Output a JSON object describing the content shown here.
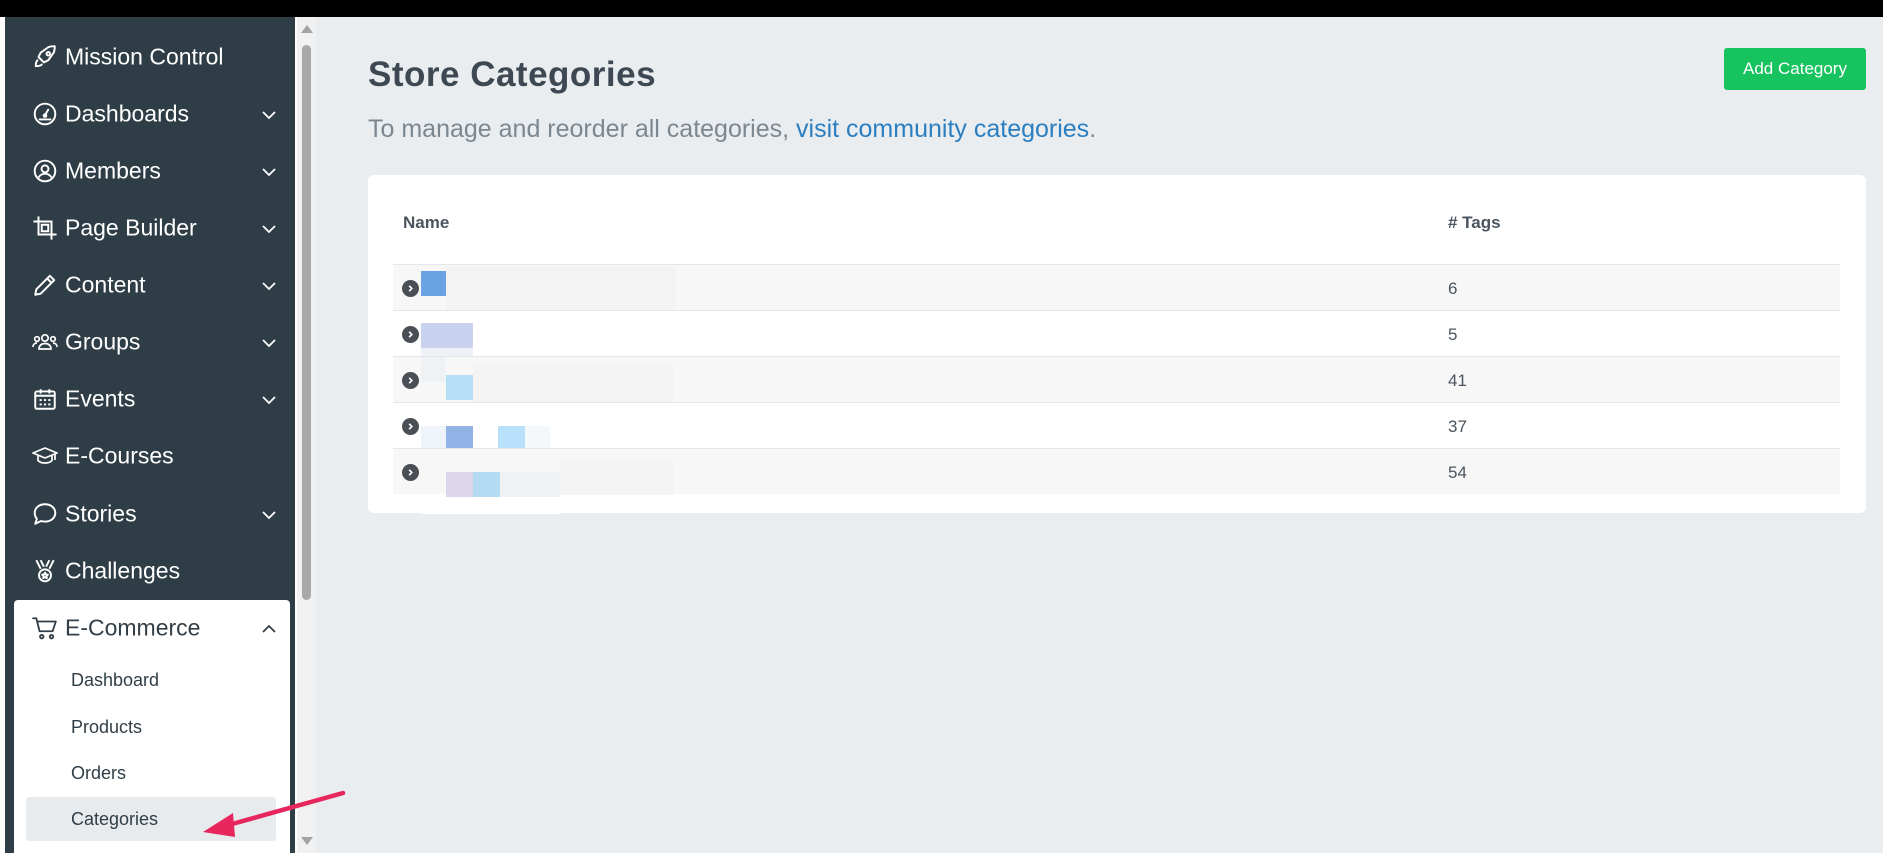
{
  "sidebar": {
    "items": [
      {
        "label": "Mission Control",
        "icon": "rocket-icon",
        "has_chevron": false
      },
      {
        "label": "Dashboards",
        "icon": "speedometer-icon",
        "has_chevron": true
      },
      {
        "label": "Members",
        "icon": "user-circle-icon",
        "has_chevron": true
      },
      {
        "label": "Page Builder",
        "icon": "crop-icon",
        "has_chevron": true
      },
      {
        "label": "Content",
        "icon": "pencil-icon",
        "has_chevron": true
      },
      {
        "label": "Groups",
        "icon": "users-icon",
        "has_chevron": true
      },
      {
        "label": "Events",
        "icon": "calendar-icon",
        "has_chevron": true
      },
      {
        "label": "E-Courses",
        "icon": "graduation-cap-icon",
        "has_chevron": false
      },
      {
        "label": "Stories",
        "icon": "chat-bubble-icon",
        "has_chevron": true
      },
      {
        "label": "Challenges",
        "icon": "medal-icon",
        "has_chevron": false
      }
    ],
    "ecommerce": {
      "label": "E-Commerce",
      "icon": "cart-icon",
      "sub_items": [
        {
          "label": "Dashboard"
        },
        {
          "label": "Products"
        },
        {
          "label": "Orders"
        },
        {
          "label": "Categories",
          "active": true
        }
      ]
    }
  },
  "main": {
    "title": "Store Categories",
    "subtitle_text": "To manage and reorder all categories, ",
    "subtitle_link": "visit community categories",
    "subtitle_end": ".",
    "add_button": "Add Category",
    "table": {
      "headers": [
        "Name",
        "# Tags"
      ],
      "rows": [
        {
          "name": "",
          "tags": "6"
        },
        {
          "name": "",
          "tags": "5"
        },
        {
          "name": "",
          "tags": "41"
        },
        {
          "name": "",
          "tags": "37"
        },
        {
          "name": "",
          "tags": "54"
        }
      ]
    }
  },
  "colors": {
    "sidebar_bg": "#2f3e46",
    "main_bg": "#e9edf0",
    "accent_green": "#17c35f",
    "link_blue": "#2b7fc1",
    "annotation_arrow": "#e8265e"
  }
}
